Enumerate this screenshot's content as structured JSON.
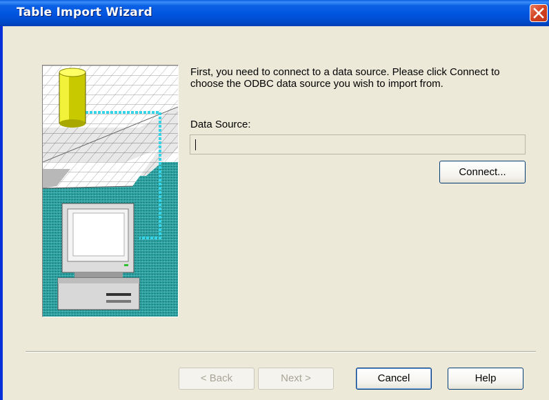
{
  "window": {
    "title": "Table Import Wizard"
  },
  "titlebar": {
    "close_icon": "close-icon"
  },
  "content": {
    "instructions": "First, you need to connect to a data source.  Please click Connect to choose the ODBC data source you wish to import from.",
    "data_source_label": "Data Source:",
    "data_source_value": "",
    "connect_label": "Connect..."
  },
  "footer": {
    "back_label": "< Back",
    "next_label": "Next >",
    "cancel_label": "Cancel",
    "help_label": "Help"
  },
  "illustration": {
    "icons": [
      "database-cylinder-icon",
      "computer-monitor-icon",
      "desktop-pc-icon"
    ],
    "colors": {
      "database": "#e6e600",
      "connection": "#35d4e8",
      "floor": "#2aa0a0"
    }
  },
  "theme": {
    "titlebar": "#0055e0",
    "dialog_bg": "#ece9d8",
    "close_button": "#d24221"
  }
}
